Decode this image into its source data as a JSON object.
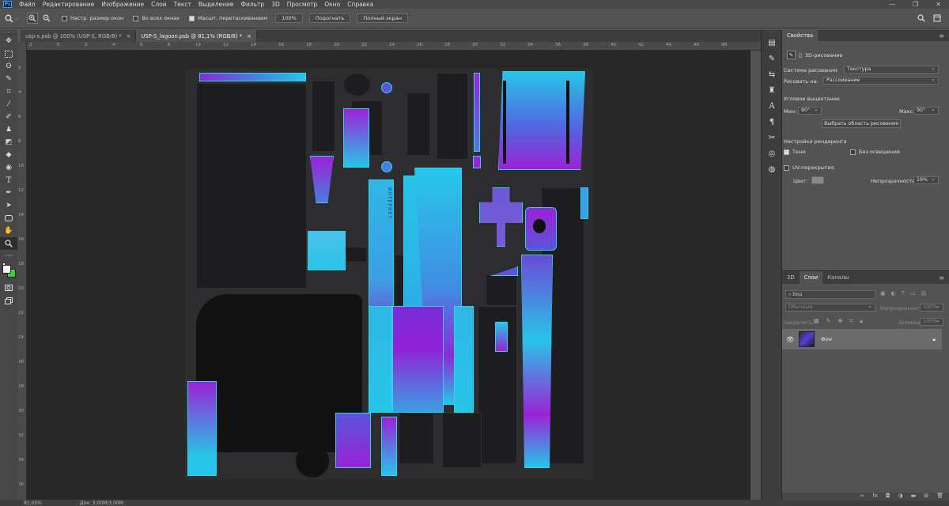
{
  "menubar": {
    "logo": "Ps",
    "items": [
      "Файл",
      "Редактирование",
      "Изображение",
      "Слои",
      "Текст",
      "Выделение",
      "Фильтр",
      "3D",
      "Просмотр",
      "Окно",
      "Справка"
    ],
    "window_controls": [
      "—",
      "❐",
      "✕"
    ]
  },
  "options": {
    "resize_windows_label": "Настр. размер окон",
    "all_windows_label": "Во всех окнах",
    "scrubby_zoom_label": "Масшт. перетаскиванием",
    "zoom_100": "100%",
    "fit_screen": "Подогнать",
    "fill_screen": "Полный экран"
  },
  "doc_tabs": [
    {
      "title": "usp-s.psb @ 100% (USP-S, RGB/8) *",
      "close": "×"
    },
    {
      "title": "USP-S_lagoon.psb @ 81,1% (RGB/8) *",
      "close": "×"
    }
  ],
  "ruler": {
    "top": [
      "2",
      "0",
      "2",
      "4",
      "6",
      "8",
      "10",
      "12",
      "14",
      "16",
      "18",
      "20",
      "22",
      "24",
      "26",
      "28",
      "30",
      "32",
      "34",
      "36",
      "38",
      "40",
      "42",
      "44",
      "46",
      "48"
    ],
    "left": [
      "2",
      "4",
      "6",
      "8",
      "10",
      "12",
      "14",
      "16",
      "18",
      "20",
      "22",
      "24",
      "26",
      "28",
      "30",
      "32",
      "34",
      "36"
    ]
  },
  "canvas_text": "ИНТЕРНЕТ",
  "status": {
    "zoom": "81,05%",
    "doc": "Док: 3,00M/3,00M"
  },
  "properties": {
    "tab": "Свойства",
    "title": "3D-рисование",
    "paint_system_label": "Система рисования:",
    "paint_system_value": "Текстура",
    "paint_on_label": "Рисовать на:",
    "paint_on_value": "Рассеивание",
    "angle_section": "Угловое выцветание",
    "min_label": "Мин:",
    "min_value": "90°",
    "max_label": "Макс:",
    "max_value": "90°",
    "select_area_button": "Выбрать область рисования",
    "render_section": "Настройки рендеринга",
    "shadows_label": "Тени",
    "no_light_label": "Без освещения",
    "uv_section": "UV-перекрытия",
    "color_label": "Цвет:",
    "opacity_label": "Непрозрачность:",
    "opacity_value": "19%"
  },
  "layers": {
    "tabs": [
      "3D",
      "Слои",
      "Каналы"
    ],
    "search_placeholder": "Вид",
    "blend_mode": "Обычные",
    "opacity_label": "Непрозрачность:",
    "opacity_value": "100%",
    "lock_label": "Закрепить:",
    "fill_label": "Заливка:",
    "fill_value": "100%",
    "layer_name": "Фон"
  }
}
